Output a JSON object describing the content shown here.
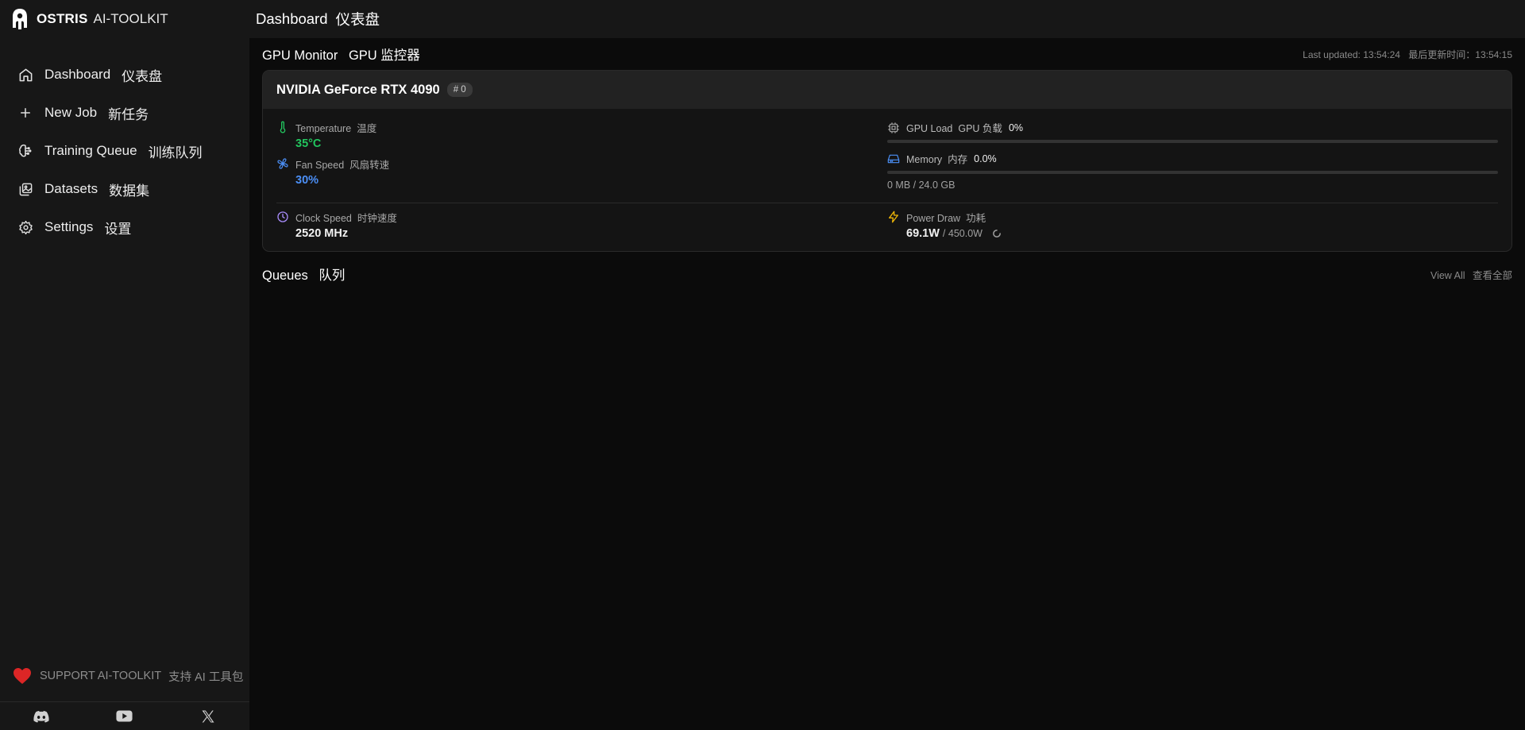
{
  "brand": {
    "name_bold": "OSTRIS",
    "name_rest": "AI-TOOLKIT"
  },
  "sidebar": {
    "items": [
      {
        "label": "Dashboard",
        "label_zh": "仪表盘",
        "icon": "home-icon"
      },
      {
        "label": "New Job",
        "label_zh": "新任务",
        "icon": "plus-icon"
      },
      {
        "label": "Training Queue",
        "label_zh": "训练队列",
        "icon": "brain-icon"
      },
      {
        "label": "Datasets",
        "label_zh": "数据集",
        "icon": "images-icon"
      },
      {
        "label": "Settings",
        "label_zh": "设置",
        "icon": "gear-icon"
      }
    ],
    "support": {
      "label": "SUPPORT AI-TOOLKIT",
      "label_zh": "支持 AI 工具包"
    },
    "social": [
      "discord-icon",
      "youtube-icon",
      "x-icon"
    ]
  },
  "header": {
    "title": "Dashboard",
    "title_zh": "仪表盘"
  },
  "gpu_monitor": {
    "title": "GPU Monitor",
    "title_zh": "GPU 监控器",
    "last_updated_label": "Last updated: 13:54:24",
    "last_updated_label_zh": "最后更新时间：13:54:15",
    "gpu": {
      "name": "NVIDIA GeForce RTX 4090",
      "index": "# 0",
      "temperature": {
        "label": "Temperature",
        "label_zh": "温度",
        "value": "35°C",
        "color": "#22c55e"
      },
      "fan_speed": {
        "label": "Fan Speed",
        "label_zh": "风扇转速",
        "value": "30%",
        "color": "#4b8ff6"
      },
      "gpu_load": {
        "label": "GPU Load",
        "label_zh": "GPU 负载",
        "value": "0%",
        "fraction": 0
      },
      "memory": {
        "label": "Memory",
        "label_zh": "内存",
        "value": "0.0%",
        "fraction": 0,
        "detail": "0 MB / 24.0 GB"
      },
      "clock_speed": {
        "label": "Clock Speed",
        "label_zh": "时钟速度",
        "value": "2520 MHz"
      },
      "power_draw": {
        "label": "Power Draw",
        "label_zh": "功耗",
        "value": "69.1W",
        "max": "/ 450.0W"
      }
    }
  },
  "queues": {
    "title": "Queues",
    "title_zh": "队列",
    "view_all": "View All",
    "view_all_zh": "查看全部"
  },
  "colors": {
    "accent_blue": "#4b8ff6",
    "green": "#22c55e",
    "power_yellow": "#eab308",
    "heart_red": "#dc2626",
    "clock_purple": "#a78bfa"
  }
}
